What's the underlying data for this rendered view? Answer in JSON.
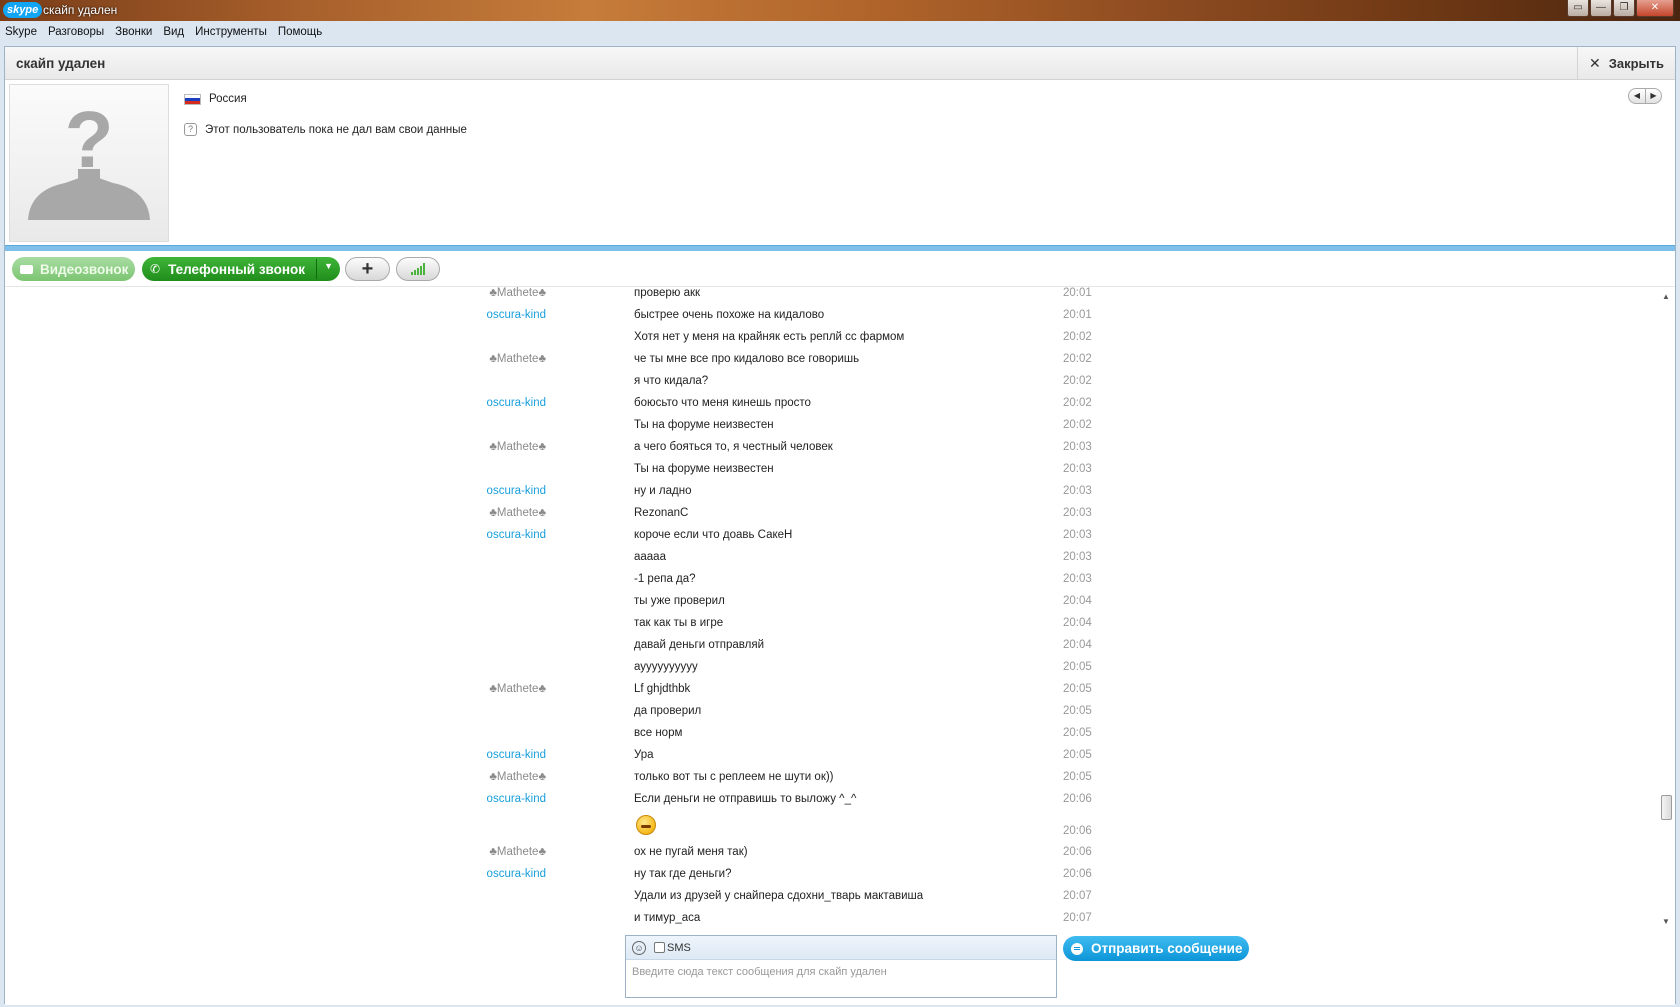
{
  "window": {
    "logo": "skype",
    "title": "скайп удален",
    "buttons": [
      "▭",
      "—",
      "❐",
      "✕"
    ]
  },
  "menu": [
    "Skype",
    "Разговоры",
    "Звонки",
    "Вид",
    "Инструменты",
    "Помощь"
  ],
  "header": {
    "contact_name": "скайп удален",
    "close_label": "Закрыть"
  },
  "profile": {
    "country": "Россия",
    "info_note": "Этот пользователь пока не дал вам свои данные"
  },
  "actions": {
    "video_label": "Видеозвонок",
    "call_label": "Телефонный звонок",
    "add_symbol": "+"
  },
  "messages": [
    {
      "author": "♣Mathete♣",
      "who": "ma",
      "text": "проверю акк",
      "time": "20:01"
    },
    {
      "author": "oscura-kind",
      "who": "os",
      "text": "быстрее очень похоже  на кидалово",
      "time": "20:01"
    },
    {
      "author": "",
      "who": "",
      "text": "Хотя нет у меня на крайняк есть реплй сс фармом",
      "time": "20:02"
    },
    {
      "author": "♣Mathete♣",
      "who": "ma",
      "text": "че ты мне все про кидалово все говоришь",
      "time": "20:02"
    },
    {
      "author": "",
      "who": "",
      "text": "я что кидала?",
      "time": "20:02"
    },
    {
      "author": "oscura-kind",
      "who": "os",
      "text": "боюсьто что меня кинешь просто",
      "time": "20:02"
    },
    {
      "author": "",
      "who": "",
      "text": "Ты на форуме неизвестен",
      "time": "20:02"
    },
    {
      "author": "♣Mathete♣",
      "who": "ma",
      "text": "а чего бояться то, я честный человек",
      "time": "20:03"
    },
    {
      "author": "",
      "who": "",
      "text": "Ты на форуме неизвестен",
      "time": "20:03"
    },
    {
      "author": "oscura-kind",
      "who": "os",
      "text": "ну и ладно",
      "time": "20:03"
    },
    {
      "author": "♣Mathete♣",
      "who": "ma",
      "text": "RezonanC",
      "time": "20:03"
    },
    {
      "author": "oscura-kind",
      "who": "os",
      "text": "короче если что доавь СакеН",
      "time": "20:03"
    },
    {
      "author": "",
      "who": "",
      "text": "ааааа",
      "time": "20:03"
    },
    {
      "author": "",
      "who": "",
      "text": "-1 репа да?",
      "time": "20:03"
    },
    {
      "author": "",
      "who": "",
      "text": "ты уже проверил",
      "time": "20:04"
    },
    {
      "author": "",
      "who": "",
      "text": "так как ты в игре",
      "time": "20:04"
    },
    {
      "author": "",
      "who": "",
      "text": "давай деньги отправляй",
      "time": "20:04"
    },
    {
      "author": "",
      "who": "",
      "text": "ауууууууууу",
      "time": "20:05"
    },
    {
      "author": "♣Mathete♣",
      "who": "ma",
      "text": "Lf ghjdthbk",
      "time": "20:05"
    },
    {
      "author": "",
      "who": "",
      "text": "да проверил",
      "time": "20:05"
    },
    {
      "author": "",
      "who": "",
      "text": "все норм",
      "time": "20:05"
    },
    {
      "author": "oscura-kind",
      "who": "os",
      "text": "Ура",
      "time": "20:05"
    },
    {
      "author": "♣Mathete♣",
      "who": "ma",
      "text": "только вот ты с реплеем не шути ок))",
      "time": "20:05"
    },
    {
      "author": "oscura-kind",
      "who": "os",
      "text": "Если деньги не отправишь то выложу ^_^",
      "time": "20:06"
    },
    {
      "author": "",
      "who": "",
      "text": "",
      "emoticon": "laugh",
      "time": "20:06"
    },
    {
      "author": "♣Mathete♣",
      "who": "ma",
      "text": "ох не пугай меня так)",
      "time": "20:06"
    },
    {
      "author": "oscura-kind",
      "who": "os",
      "text": "ну так где деньги?",
      "time": "20:06"
    },
    {
      "author": "",
      "who": "",
      "text": "Удали из друзей у снайпера сдохни_тварь мактавиша",
      "time": "20:07"
    },
    {
      "author": "",
      "who": "",
      "text": "и тимур_аса",
      "time": "20:07"
    }
  ],
  "composer": {
    "sms_label": "SMS",
    "placeholder": "Введите сюда текст сообщения для скайп удален",
    "send_label": "Отправить сообщение"
  }
}
